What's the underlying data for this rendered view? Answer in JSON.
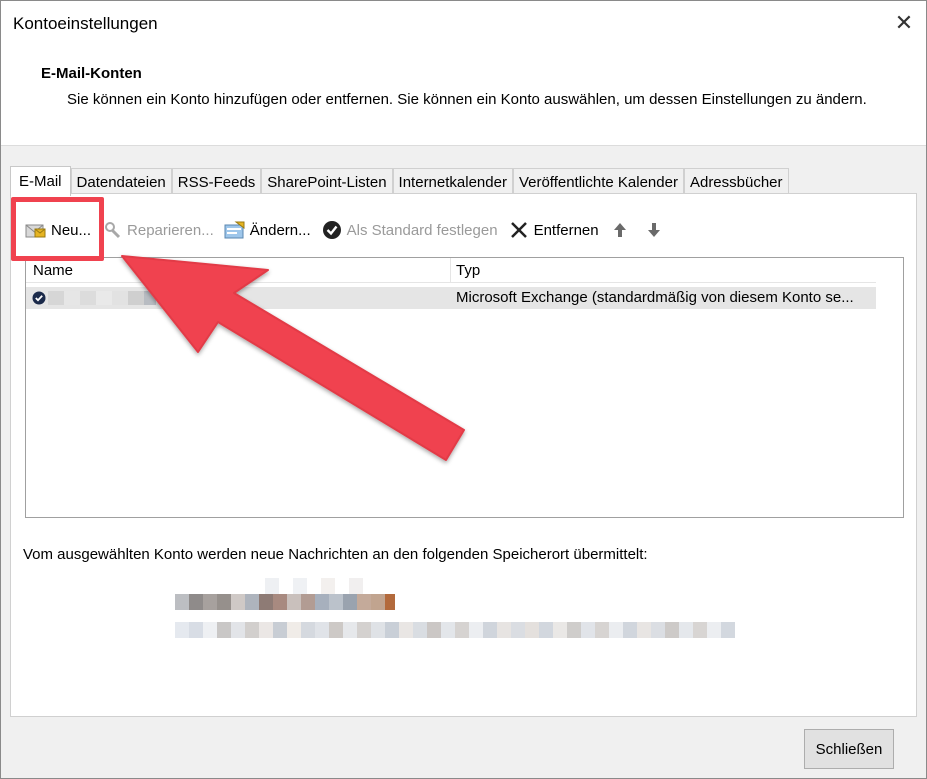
{
  "window": {
    "title": "Kontoeinstellungen",
    "close_label": "✕"
  },
  "header": {
    "heading": "E-Mail-Konten",
    "description": "Sie können ein Konto hinzufügen oder entfernen. Sie können ein Konto auswählen, um dessen Einstellungen zu ändern."
  },
  "tabs": [
    {
      "label": "E-Mail"
    },
    {
      "label": "Datendateien"
    },
    {
      "label": "RSS-Feeds"
    },
    {
      "label": "SharePoint-Listen"
    },
    {
      "label": "Internetkalender"
    },
    {
      "label": "Veröffentlichte Kalender"
    },
    {
      "label": "Adressbücher"
    }
  ],
  "toolbar": {
    "new_label": "Neu...",
    "repair_label": "Reparieren...",
    "change_label": "Ändern...",
    "default_label": "Als Standard festlegen",
    "remove_label": "Entfernen"
  },
  "list": {
    "headers": {
      "name": "Name",
      "type": "Typ"
    },
    "rows": [
      {
        "type": "Microsoft Exchange (standardmäßig von diesem Konto se..."
      }
    ]
  },
  "info": {
    "text": "Vom ausgewählten Konto werden neue Nachrichten an den folgenden Speicherort übermittelt:"
  },
  "footer": {
    "close_button_label": "Schließen"
  },
  "colors": {
    "highlight": "#f0424f",
    "selection_row": "#e5e5e5"
  }
}
